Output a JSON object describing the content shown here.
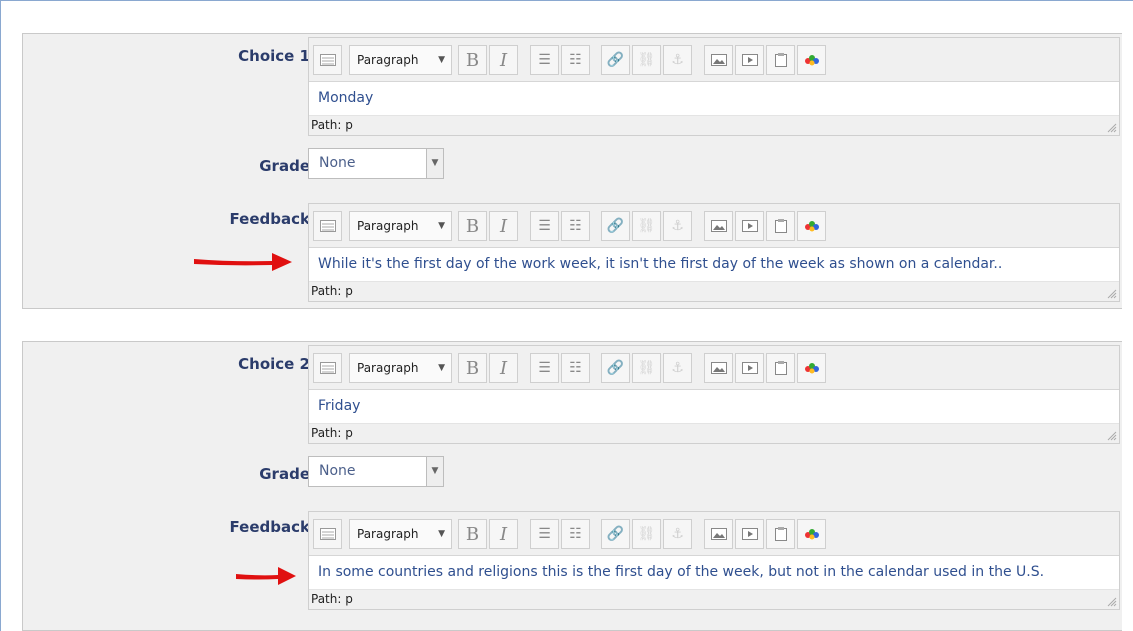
{
  "choices": [
    {
      "label": "Choice 1",
      "answer_text": "Monday",
      "answer_path": "Path: p",
      "grade_label": "Grade",
      "grade_value": "None",
      "feedback_label": "Feedback",
      "feedback_text": "While it's the first day of the work week, it isn't the first day of the week as shown on a calendar..",
      "feedback_path": "Path: p"
    },
    {
      "label": "Choice 2",
      "answer_text": "Friday",
      "answer_path": "Path: p",
      "grade_label": "Grade",
      "grade_value": "None",
      "feedback_label": "Feedback",
      "feedback_text": "In some countries and religions this is the first day of the week, but not in the calendar used in the U.S.",
      "feedback_path": "Path: p"
    }
  ],
  "toolbar": {
    "format_select": "Paragraph",
    "icons": [
      "toolbar-toggle-icon",
      "bold-icon",
      "italic-icon",
      "bullet-list-icon",
      "numbered-list-icon",
      "link-icon",
      "unlink-icon",
      "anchor-icon",
      "image-icon",
      "media-icon",
      "paste-icon",
      "spellcheck-icon"
    ]
  },
  "colors": {
    "label": "#2b3c6b",
    "body_text": "#2f4f8f",
    "panel_bg": "#f0f0f0",
    "arrow": "#e01010"
  }
}
